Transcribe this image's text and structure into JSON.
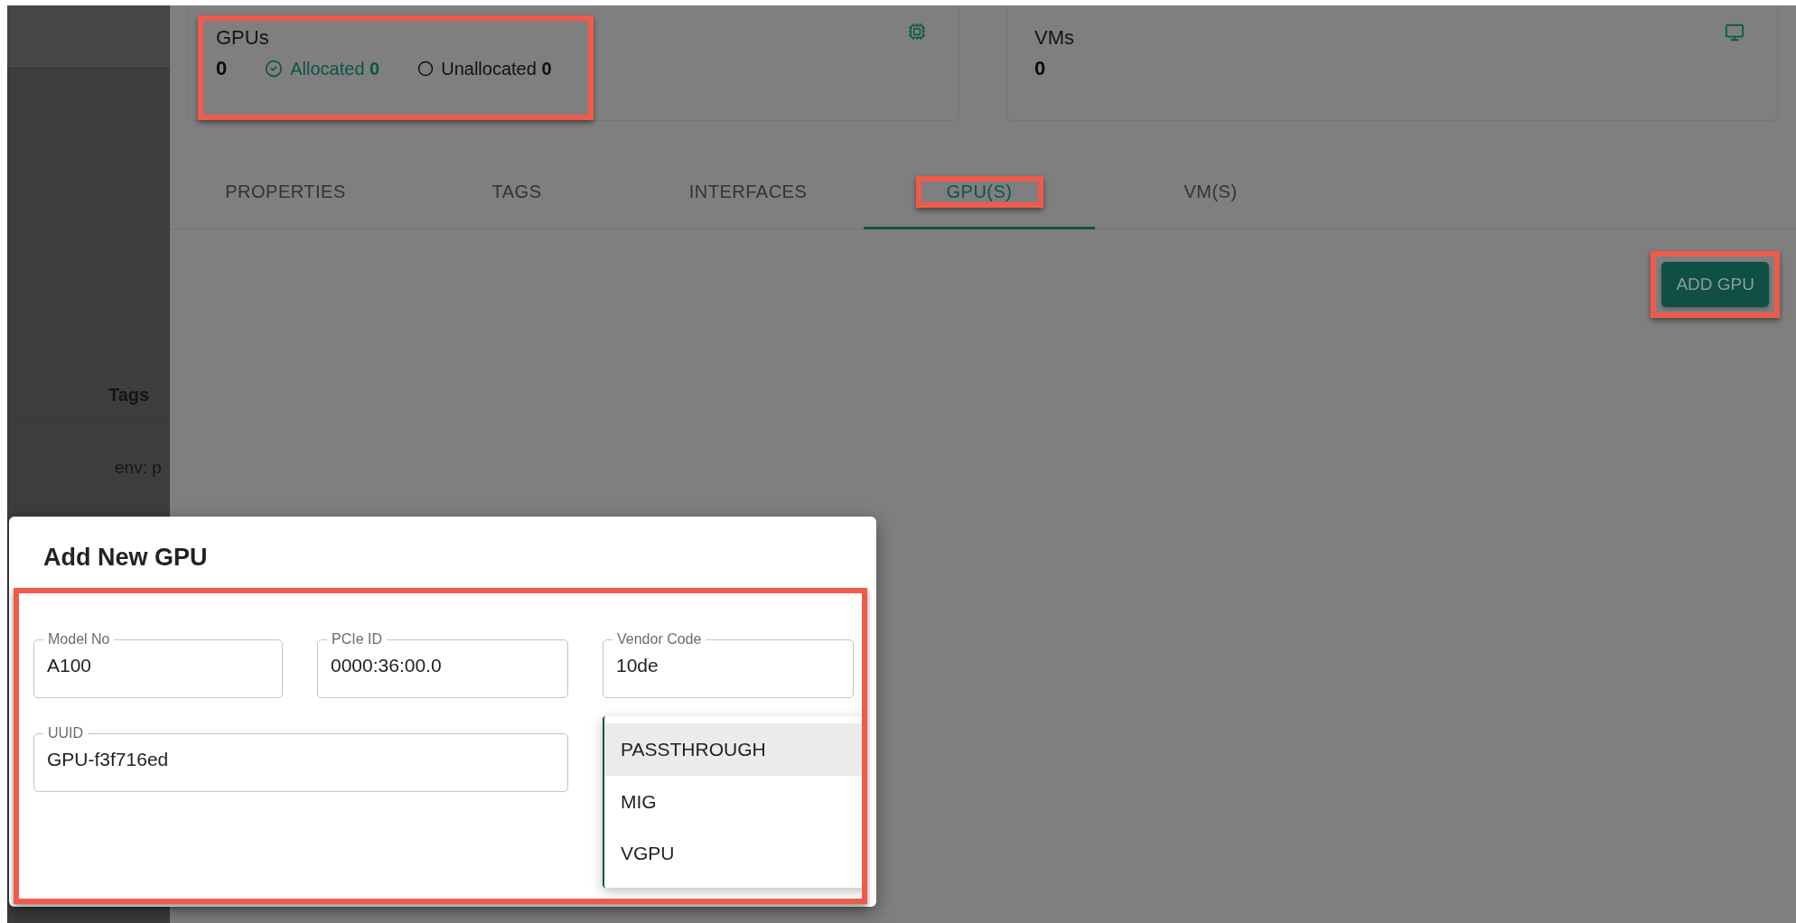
{
  "sidebar": {
    "column_header": "Tags",
    "cells": [
      "env: p"
    ]
  },
  "summary_cards": [
    {
      "kind": "gpus",
      "title": "GPUs",
      "value": "0",
      "highlighted": true,
      "stats": [
        {
          "kind": "allocated",
          "label": "Allocated",
          "value": "0"
        },
        {
          "kind": "unallocated",
          "label": "Unallocated",
          "value": "0"
        }
      ]
    },
    {
      "kind": "vms",
      "title": "VMs",
      "value": "0",
      "highlighted": false
    }
  ],
  "tabs": [
    {
      "label": "PROPERTIES",
      "selected": false,
      "highlighted": false
    },
    {
      "label": "TAGS",
      "selected": false,
      "highlighted": false
    },
    {
      "label": "INTERFACES",
      "selected": false,
      "highlighted": false
    },
    {
      "label": "GPU(S)",
      "selected": true,
      "highlighted": true
    },
    {
      "label": "VM(S)",
      "selected": false,
      "highlighted": false
    }
  ],
  "add_button": {
    "label": "ADD GPU",
    "highlighted": true
  },
  "dialog": {
    "title": "Add New GPU",
    "form_highlighted": true,
    "fields": [
      {
        "label": "Model No",
        "value": "A100"
      },
      {
        "label": "PCIe ID",
        "value": "0000:36:00.0"
      },
      {
        "label": "Vendor Code",
        "value": "10de"
      },
      {
        "label": "UUID",
        "value": "GPU-f3f716ed"
      }
    ],
    "menu": {
      "options": [
        {
          "label": "PASSTHROUGH",
          "selected": true
        },
        {
          "label": "MIG",
          "selected": false
        },
        {
          "label": "VGPU",
          "selected": false
        }
      ]
    }
  }
}
